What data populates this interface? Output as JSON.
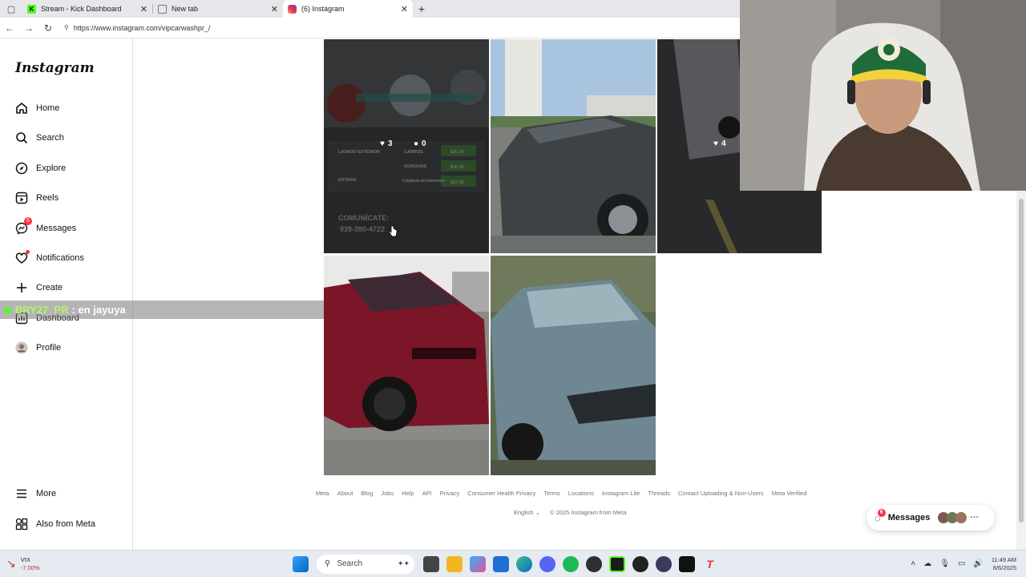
{
  "browser": {
    "tabs": [
      {
        "label": "Stream - Kick Dashboard",
        "color": "#53fc18"
      },
      {
        "label": "New tab",
        "color": "#888888"
      },
      {
        "label": "(6) Instagram",
        "color": "#e1306c"
      }
    ],
    "url": "https://www.instagram.com/vipcarwashpr_/"
  },
  "sidebar": {
    "logo": "Instagram",
    "items": [
      {
        "label": "Home",
        "icon": "home-icon"
      },
      {
        "label": "Search",
        "icon": "search-icon"
      },
      {
        "label": "Explore",
        "icon": "compass-icon"
      },
      {
        "label": "Reels",
        "icon": "reels-icon"
      },
      {
        "label": "Messages",
        "icon": "messenger-icon",
        "badge": "6"
      },
      {
        "label": "Notifications",
        "icon": "heart-icon"
      },
      {
        "label": "Create",
        "icon": "plus-icon"
      },
      {
        "label": "Dashboard",
        "icon": "chart-icon"
      },
      {
        "label": "Profile",
        "icon": "avatar-icon"
      }
    ],
    "more": "More",
    "also_from_meta": "Also from Meta"
  },
  "posts": {
    "p1": {
      "likes": "3",
      "comments": "0",
      "text_header": "LAVADO EXTERIOR",
      "text_carros": "CARROS",
      "text_guaguas": "GUAGUAS",
      "text_extras": "EXTRAS",
      "text_limpieza": "Limpieza de Interiores",
      "price_1": "$20.00",
      "price_2": "$30.00",
      "price_3": "$10.00",
      "contact": "COMUNÍCATE:",
      "phone": "939-380-4722"
    },
    "p3": {
      "likes": "4"
    }
  },
  "chat": {
    "user": "BRY27_PR",
    "message": ": en jayuya"
  },
  "footer": {
    "links": [
      "Meta",
      "About",
      "Blog",
      "Jobs",
      "Help",
      "API",
      "Privacy",
      "Consumer Health Privacy",
      "Terms",
      "Locations",
      "Instagram Lite",
      "Threads",
      "Contact Uploading & Non-Users",
      "Meta Verified"
    ],
    "language": "English",
    "copyright": "© 2025 Instagram from Meta"
  },
  "messages_pill": {
    "label": "Messages",
    "badge": "6"
  },
  "taskbar": {
    "weather_title": "VIX",
    "weather_value": "-7.00%",
    "search": "Search",
    "time": "11:49 AM",
    "date": "8/6/2025"
  },
  "colors": {
    "instagram_red": "#ff3040",
    "kick_green": "#53fc18",
    "chat_user": "#b7f36b"
  }
}
